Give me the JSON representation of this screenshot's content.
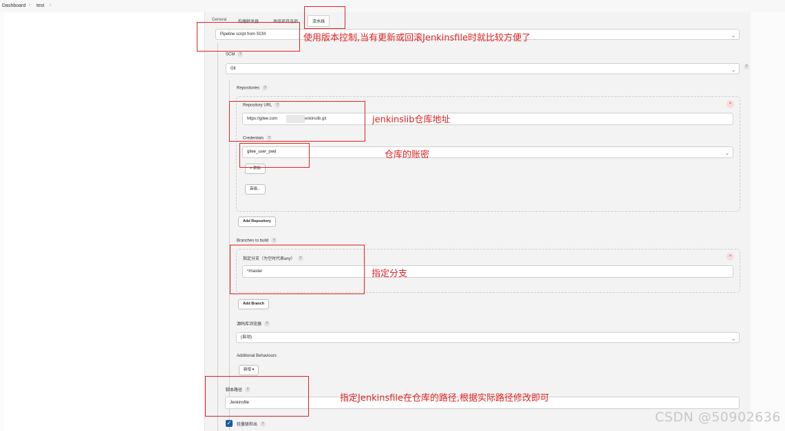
{
  "breadcrumb": {
    "items": [
      "Dashboard",
      "test"
    ],
    "sep": "›"
  },
  "tabs": [
    "General",
    "构建触发器",
    "高级项目选项",
    "流水线"
  ],
  "definition": {
    "value": "Pipeline script from SCM"
  },
  "scm": {
    "label": "SCM",
    "value": "Git"
  },
  "repositories": {
    "label": "Repositories",
    "url_label": "Repository URL",
    "url_value_prefix": "https://gitee.com",
    "url_value_suffix": "enkinslib.git",
    "credentials_label": "Credentials",
    "credentials_value": "gitee_user_pwd",
    "add_label": "+ 添加",
    "advanced_label": "高级...",
    "add_repository_label": "Add Repository"
  },
  "branches": {
    "label": "Branches to build",
    "specifier_label": "指定分支（为空时代表any）",
    "specifier_value": "*/master",
    "add_branch_label": "Add Branch"
  },
  "browser": {
    "label": "源码库浏览器",
    "value": "(自动)"
  },
  "behaviours": {
    "label": "Additional Behaviours",
    "add_label": "新增 ▾"
  },
  "script_path": {
    "label": "脚本路径",
    "value": "Jenkinsfile"
  },
  "lightweight": {
    "label": "轻量级检出",
    "checked": true
  },
  "help_mark": "?",
  "close_mark": "×",
  "chevron": "⌄",
  "check_mark": "✓",
  "annotations": {
    "scm_note": "使用版本控制,当有更新或回滚Jenkinsfile时就比较方便了",
    "repo_note": "jenkinslib仓库地址",
    "cred_note": "仓库的账密",
    "branch_note": "指定分支",
    "path_note": "指定Jenkinsfile在仓库的路径,根据实际路径修改即可"
  },
  "watermark": "CSDN @50902636",
  "colors": {
    "annotation_red": "#e02020",
    "checkbox_blue": "#1a5aa0"
  }
}
